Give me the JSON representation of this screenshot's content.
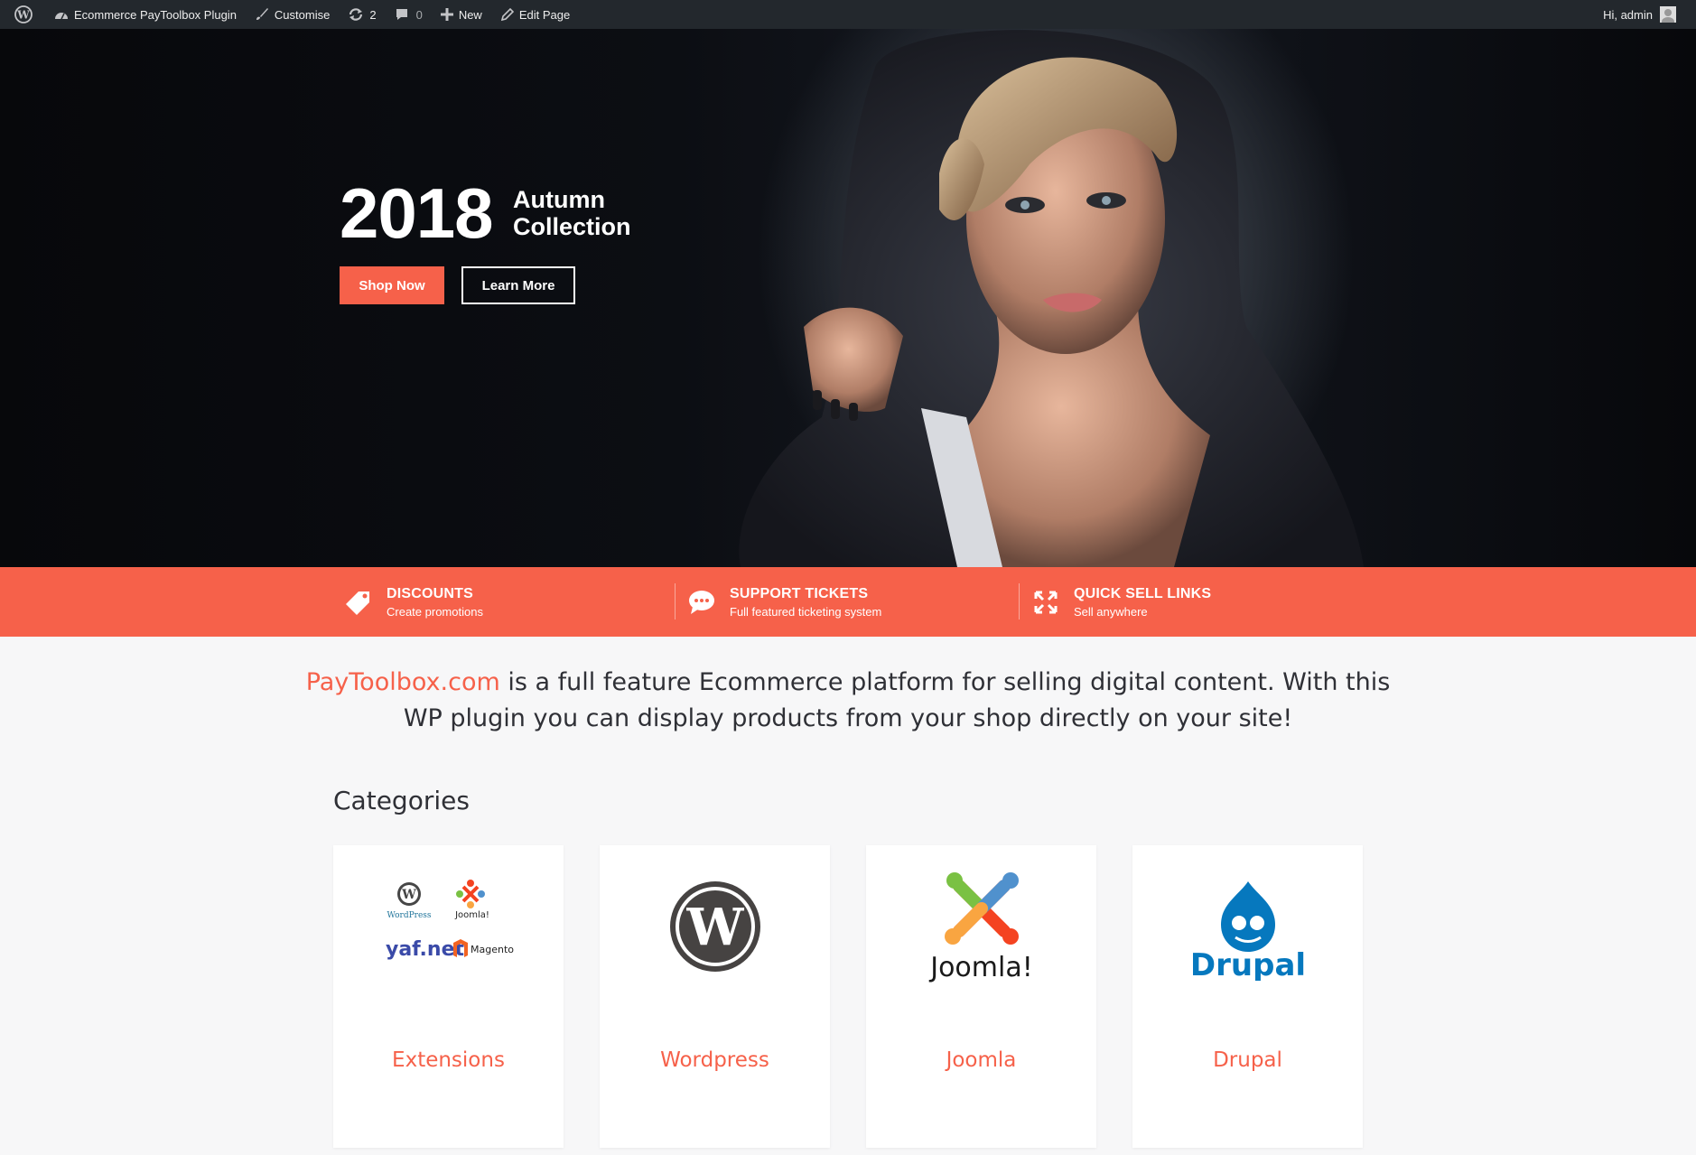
{
  "adminbar": {
    "site_name": "Ecommerce PayToolbox Plugin",
    "customise": "Customise",
    "updates_count": "2",
    "comments_count": "0",
    "new": "New",
    "edit_page": "Edit Page",
    "greeting": "Hi, admin"
  },
  "hero": {
    "year": "2018",
    "line1": "Autumn",
    "line2": "Collection",
    "shop_button": "Shop Now",
    "learn_button": "Learn More"
  },
  "features": [
    {
      "title": "DISCOUNTS",
      "subtitle": "Create promotions",
      "icon": "tag-icon"
    },
    {
      "title": "SUPPORT TICKETS",
      "subtitle": "Full featured ticketing system",
      "icon": "chat-icon"
    },
    {
      "title": "QUICK SELL LINKS",
      "subtitle": "Sell anywhere",
      "icon": "expand-icon"
    }
  ],
  "intro": {
    "link_text": "PayToolbox.com",
    "text": " is a full feature Ecommerce platform for selling digital content. With this WP plugin you can display products from your shop directly on your site!"
  },
  "categories": {
    "title": "Categories",
    "items": [
      {
        "name": "Extensions",
        "logo_labels": [
          "WordPress",
          "Joomla!",
          "yaf.net",
          "Magento"
        ]
      },
      {
        "name": "Wordpress"
      },
      {
        "name": "Joomla",
        "logo_label": "Joomla!"
      },
      {
        "name": "Drupal",
        "logo_label": "Drupal"
      }
    ]
  },
  "colors": {
    "accent": "#f6614a",
    "adminbar": "#23282d",
    "text": "#2f3036"
  }
}
